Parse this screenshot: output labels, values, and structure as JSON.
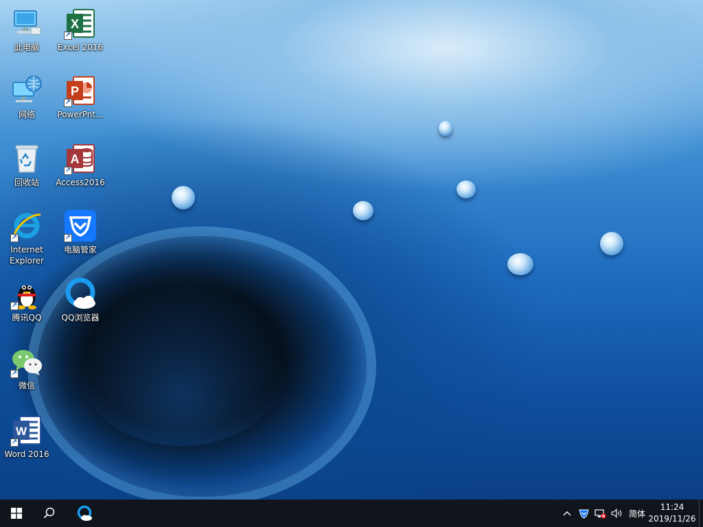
{
  "desktop": {
    "icons": [
      {
        "label": "此电脑"
      },
      {
        "label": "Excel 2016"
      },
      {
        "label": "网络"
      },
      {
        "label": "PowerPnt..."
      },
      {
        "label": "回收站"
      },
      {
        "label": "Access2016"
      },
      {
        "label": "Internet\nExplorer"
      },
      {
        "label": "电脑管家"
      },
      {
        "label": "腾讯QQ"
      },
      {
        "label": "QQ浏览器"
      },
      {
        "label": "微信"
      },
      {
        "label": "Word 2016"
      }
    ]
  },
  "taskbar": {
    "start_icon": "windows-logo-icon",
    "search_icon": "search-icon",
    "pinned_app_icon": "qq-browser-icon",
    "tray": {
      "ime_label": "简体",
      "time": "11:24",
      "date": "2019/11/26"
    }
  },
  "colors": {
    "taskbar_bg": "#10151c",
    "excel": "#1e7145",
    "powerpoint": "#c43e1c",
    "access": "#a4373a",
    "word": "#2b579a",
    "pc_manager": "#1677ff"
  }
}
